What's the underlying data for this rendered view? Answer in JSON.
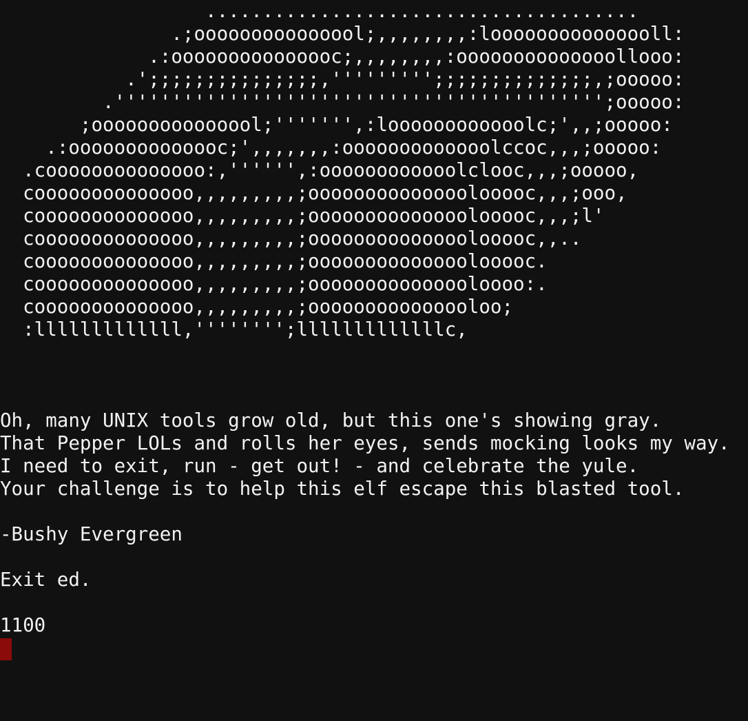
{
  "ascii_art": [
    "                  ......................................",
    "               .;ooooooooooooool;,,,,,,,,:looooooooooooooll:",
    "             .:ooooooooooooooc;,,,,,,,,:oooooooooooooollooo:",
    "           .';;;;;;;;;;;;;;;,''''''''';;;;;;;;;;;;;;,;ooooo:",
    "         .''''''''''''''''''''''''''''''''''''''''''';ooooo:",
    "       ;ooooooooooooool;''''''',:loooooooooooolc;',,;ooooo:",
    "    .:oooooooooooooc;',,,,,,,:ooooooooooooolccoc,,,;ooooo:",
    "  .coooooooooooooo:,'''''',:oooooooooooolclooc,,,;ooooo,",
    "  coooooooooooooo,,,,,,,,,;oooooooooooooolooooc,,,;ooo,",
    "  coooooooooooooo,,,,,,,,,;oooooooooooooolooooc,,,;l'",
    "  coooooooooooooo,,,,,,,,,;oooooooooooooolooooc,,..",
    "  coooooooooooooo,,,,,,,,,;oooooooooooooolooooc.",
    "  coooooooooooooo,,,,,,,,,;ooooooooooooooloooo:.",
    "  coooooooooooooo,,,,,,,,,;ooooooooooooooloo;",
    "  :lllllllllllll,'''''''';lllllllllllllc,"
  ],
  "poem": [
    "Oh, many UNIX tools grow old, but this one's showing gray.",
    "That Pepper LOLs and rolls her eyes, sends mocking looks my way.",
    "I need to exit, run - get out! - and celebrate the yule.",
    "Your challenge is to help this elf escape this blasted tool."
  ],
  "signature": "-Bushy Evergreen",
  "task": "Exit ed.",
  "output": "1100",
  "colors": {
    "background": "#111111",
    "text": "#f2f2f2",
    "cursor": "#8b0a0a"
  }
}
